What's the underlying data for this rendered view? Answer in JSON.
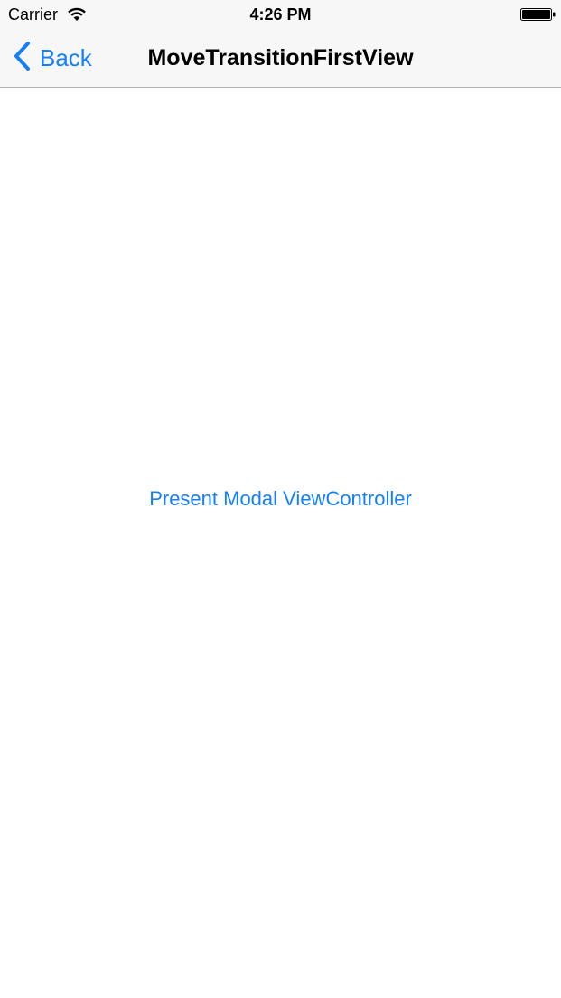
{
  "status_bar": {
    "carrier": "Carrier",
    "time": "4:26 PM",
    "wifi_icon": "wifi-icon",
    "battery_icon": "battery-icon",
    "battery_level": 1.0
  },
  "nav_bar": {
    "back_label": "Back",
    "back_icon": "chevron-left-icon",
    "title": "MoveTransitionFirstView"
  },
  "main": {
    "present_button_label": "Present Modal ViewController"
  },
  "colors": {
    "tint": "#157efb",
    "bar_background": "#f7f7f7",
    "separator": "#b2b2b2",
    "background": "#ffffff"
  }
}
